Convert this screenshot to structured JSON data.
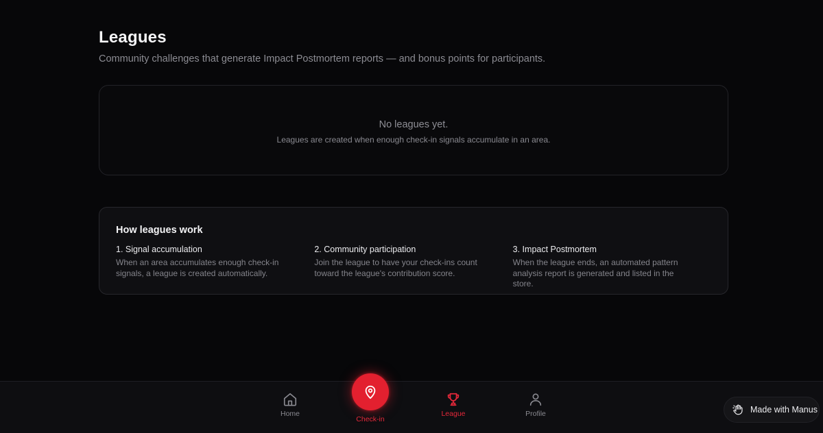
{
  "header": {
    "title": "Leagues",
    "subtitle": "Community challenges that generate Impact Postmortem reports — and bonus points for participants."
  },
  "empty_state": {
    "title": "No leagues yet.",
    "description": "Leagues are created when enough check-in signals accumulate in an area."
  },
  "how_it_works": {
    "title": "How leagues work",
    "steps": [
      {
        "title": "1. Signal accumulation",
        "description": "When an area accumulates enough check-in signals, a league is created automatically."
      },
      {
        "title": "2. Community participation",
        "description": "Join the league to have your check-ins count toward the league's contribution score."
      },
      {
        "title": "3. Impact Postmortem",
        "description": "When the league ends, an automated pattern analysis report is generated and listed in the store."
      }
    ]
  },
  "bottom_nav": {
    "items": [
      {
        "label": "Home",
        "icon": "home-icon",
        "active": false
      },
      {
        "label": "Check-in",
        "icon": "map-pin-icon",
        "active": false
      },
      {
        "label": "League",
        "icon": "trophy-icon",
        "active": true
      },
      {
        "label": "Profile",
        "icon": "user-icon",
        "active": false
      }
    ]
  },
  "badge": {
    "label": "Made with Manus",
    "icon": "manus-hand-icon"
  },
  "colors": {
    "background": "#070709",
    "accent": "#e3202f",
    "muted_text": "#8a8a91",
    "card_border": "#27272c"
  }
}
